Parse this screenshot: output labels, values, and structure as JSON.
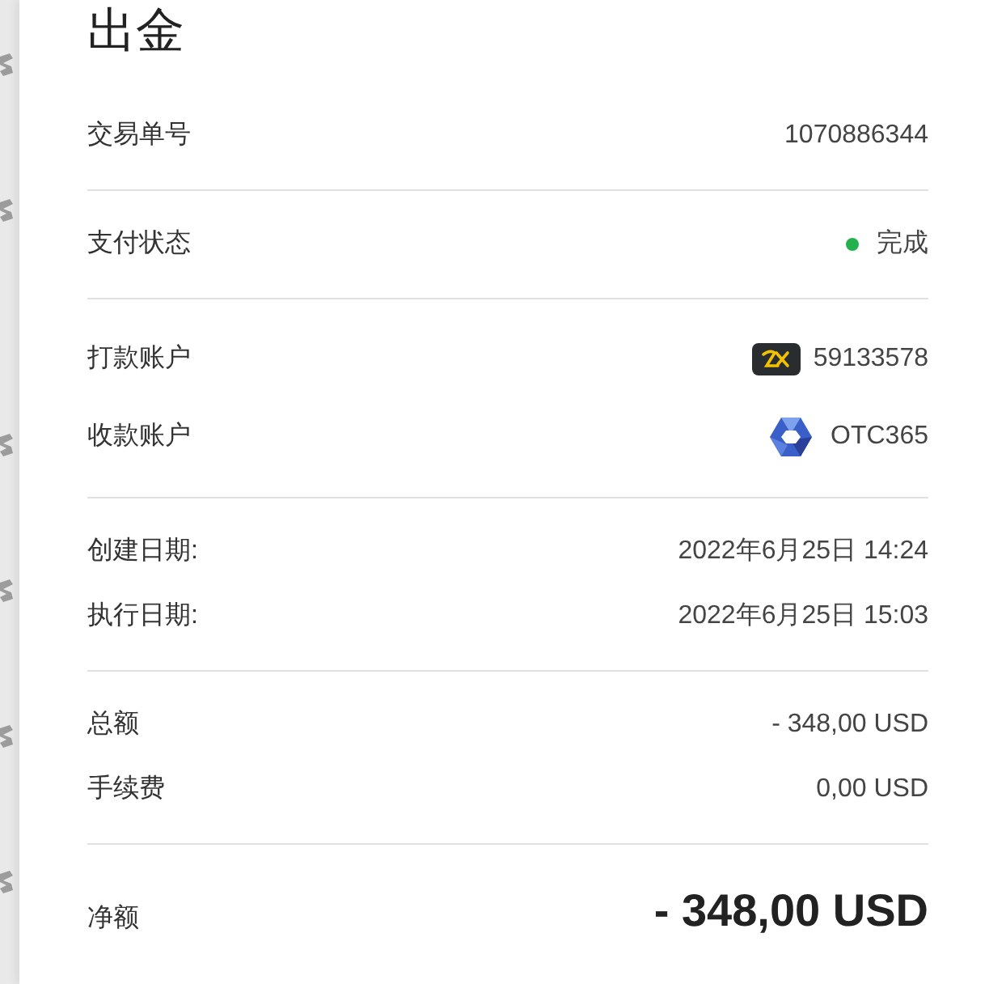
{
  "title": "出金",
  "sections": [
    {
      "rows": [
        {
          "kind": "text",
          "label": "交易单号",
          "value": "1070886344"
        }
      ]
    },
    {
      "rows": [
        {
          "kind": "status",
          "label": "支付状态",
          "value": "完成",
          "color": "#22b14c"
        }
      ]
    },
    {
      "rows": [
        {
          "kind": "tile",
          "label": "打款账户",
          "value": "59133578"
        },
        {
          "kind": "cube",
          "label": "收款账户",
          "value": "OTC365"
        }
      ]
    },
    {
      "rows": [
        {
          "kind": "text",
          "label": "创建日期:",
          "value": "2022年6月25日 14:24"
        },
        {
          "kind": "text",
          "label": "执行日期:",
          "value": "2022年6月25日 15:03"
        }
      ]
    },
    {
      "rows": [
        {
          "kind": "text",
          "label": "总额",
          "value": "- 348,00 USD"
        },
        {
          "kind": "text",
          "label": "手续费",
          "value": "0,00 USD"
        }
      ]
    },
    {
      "rows": [
        {
          "kind": "net",
          "label": "净额",
          "value": "- 348,00 USD"
        }
      ]
    }
  ]
}
